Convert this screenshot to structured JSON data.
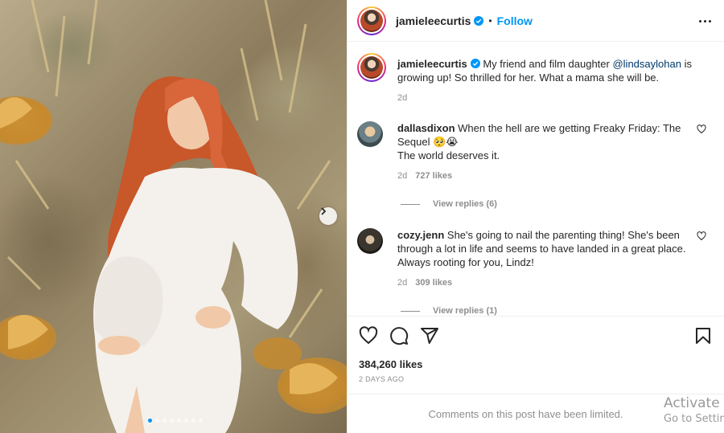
{
  "post": {
    "image_alt": "Woman in white dress among cactus plants",
    "carousel_dots": 8,
    "active_dot": 0,
    "next_icon": "chevron-right-icon"
  },
  "header": {
    "username": "jamieleecurtis",
    "separator": "•",
    "follow_label": "Follow",
    "more_icon": "more-horizontal-icon"
  },
  "caption": {
    "username": "jamieleecurtis",
    "text_before": " My friend and film daughter ",
    "mention": "@lindsaylohan",
    "text_after": " is growing up! So thrilled for her. What a mama she will be.",
    "time": "2d"
  },
  "comments": [
    {
      "username": "dallasdixon",
      "text": " When the hell are we getting Freaky Friday: The Sequel 🥺😭",
      "text2": "The world deserves it.",
      "time": "2d",
      "likes": "727 likes",
      "replies": "View replies (6)"
    },
    {
      "username": "cozy.jenn",
      "text": " She's going to nail the parenting thing! She's been through a lot in life and seems to have landed in a great place. Always rooting for you, Lindz!",
      "time": "2d",
      "likes": "309 likes",
      "replies": "View replies (1)"
    }
  ],
  "actions": {
    "like_icon": "heart-icon",
    "comment_icon": "comment-icon",
    "share_icon": "send-icon",
    "save_icon": "bookmark-icon",
    "likes_count": "384,260 likes",
    "date": "2 DAYS AGO"
  },
  "footer": {
    "limited_text": "Comments on this post have been limited."
  },
  "watermark": {
    "line1": "Activate W",
    "line2": "Go to Settin"
  },
  "colors": {
    "accent": "#0095f6",
    "text": "#262626",
    "muted": "#8e8e8e",
    "mention": "#00376b"
  }
}
